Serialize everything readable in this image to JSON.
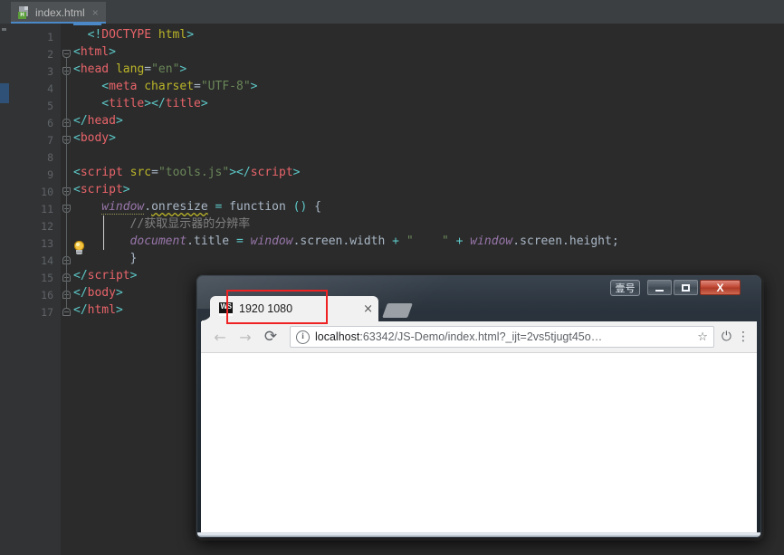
{
  "ide": {
    "tab": {
      "label": "index.html",
      "close_glyph": "×",
      "icon_badge": "H",
      "icon_name": "html-file-icon"
    },
    "editor": {
      "line_numbers": [
        "1",
        "2",
        "3",
        "4",
        "5",
        "6",
        "7",
        "8",
        "9",
        "10",
        "11",
        "12",
        "13",
        "14",
        "15",
        "16",
        "17"
      ],
      "lines": [
        {
          "n": 1,
          "text": "<!DOCTYPE html>"
        },
        {
          "n": 2,
          "text": "<html>"
        },
        {
          "n": 3,
          "text": "<head lang=\"en\">"
        },
        {
          "n": 4,
          "text": "    <meta charset=\"UTF-8\">"
        },
        {
          "n": 5,
          "text": "    <title></title>"
        },
        {
          "n": 6,
          "text": "</head>"
        },
        {
          "n": 7,
          "text": "<body>"
        },
        {
          "n": 8,
          "text": ""
        },
        {
          "n": 9,
          "text": "<script src=\"tools.js\"></script>"
        },
        {
          "n": 10,
          "text": "<script>"
        },
        {
          "n": 11,
          "text": "    window.onresize = function () {"
        },
        {
          "n": 12,
          "text": "        //获取显示器的分辨率"
        },
        {
          "n": 13,
          "text": "        document.title = window.screen.width + \"    \" + window.screen.height;"
        },
        {
          "n": 14,
          "text": "    }"
        },
        {
          "n": 15,
          "text": "</script>"
        },
        {
          "n": 16,
          "text": "</body>"
        },
        {
          "n": 17,
          "text": "</html>"
        }
      ],
      "comment_text": "//获取显示器的分辨率",
      "intention_icon": "lightbulb-icon"
    },
    "colors": {
      "background": "#2b2b2b",
      "gutter": "#313335",
      "tab_active_underline": "#4a88c7",
      "tag": "#e8646a",
      "bracket": "#5ec8c8",
      "attribute": "#bbb529",
      "string": "#6a8759",
      "comment": "#808080",
      "global_var": "#9876aa",
      "plain": "#a9b7c6"
    }
  },
  "browser": {
    "window_buttons": {
      "extra_label": "壹号",
      "minimize_glyph": "",
      "maximize_glyph": "",
      "close_glyph": "X"
    },
    "tab": {
      "title": "1920 1080",
      "favicon_text": "WS",
      "close_glyph": "×"
    },
    "toolbar": {
      "back_glyph": "←",
      "forward_glyph": "→",
      "reload_glyph": "⟳",
      "info_glyph": "i",
      "url_host": "localhost",
      "url_rest": ":63342/JS-Demo/index.html?_ijt=2vs5tjugt45o…",
      "star_glyph": "☆",
      "power_glyph": "⏻",
      "menu_glyph": "⋮"
    },
    "page_content": ""
  },
  "annotation": {
    "highlight_color": "#ee2222",
    "target": "browser-tab-title"
  }
}
